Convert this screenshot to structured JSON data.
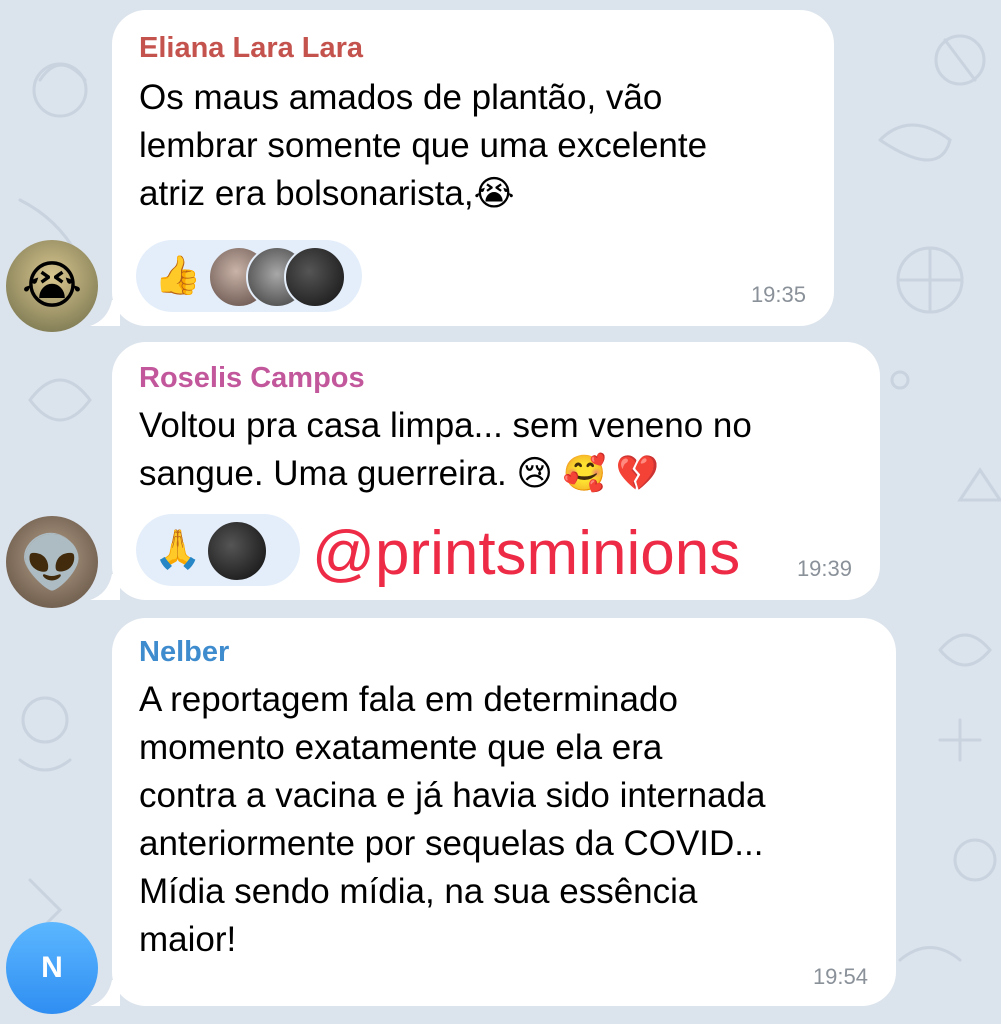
{
  "colors": {
    "background": "#dbe3ec",
    "bubble": "#ffffff",
    "reaction_pill": "#e4eefa",
    "author_1": "#c4524d",
    "author_2": "#c2579c",
    "author_3": "#3e8bce",
    "watermark": "#ee2b46"
  },
  "messages": [
    {
      "author": "Eliana Lara Lara",
      "text": "Os maus amados de plantão, vão\nlembrar somente que uma excelente\natriz era bolsonarista,😭",
      "time": "19:35",
      "reaction_emoji": "👍",
      "reaction_icon": "thumbs-up-icon",
      "avatar_icon": "crying-face-icon",
      "avatar_emoji": "😭"
    },
    {
      "author": "Roselis Campos",
      "text": "Voltou pra casa limpa... sem veneno no\nsangue. Uma guerreira. 😢 🥰 💔",
      "time": "19:39",
      "reaction_emoji": "🙏",
      "reaction_icon": "praying-hands-icon",
      "avatar_icon": "alien-icon",
      "avatar_emoji": "👽"
    },
    {
      "author": "Nelber",
      "text": "A reportagem fala em determinado\nmomento exatamente que ela era\ncontra a vacina e já havia sido internada\nanteriormente por sequelas da COVID...\nMídia sendo mídia, na sua essência\nmaior!",
      "time": "19:54",
      "avatar_letter": "N"
    }
  ],
  "watermark": "@printsminions"
}
